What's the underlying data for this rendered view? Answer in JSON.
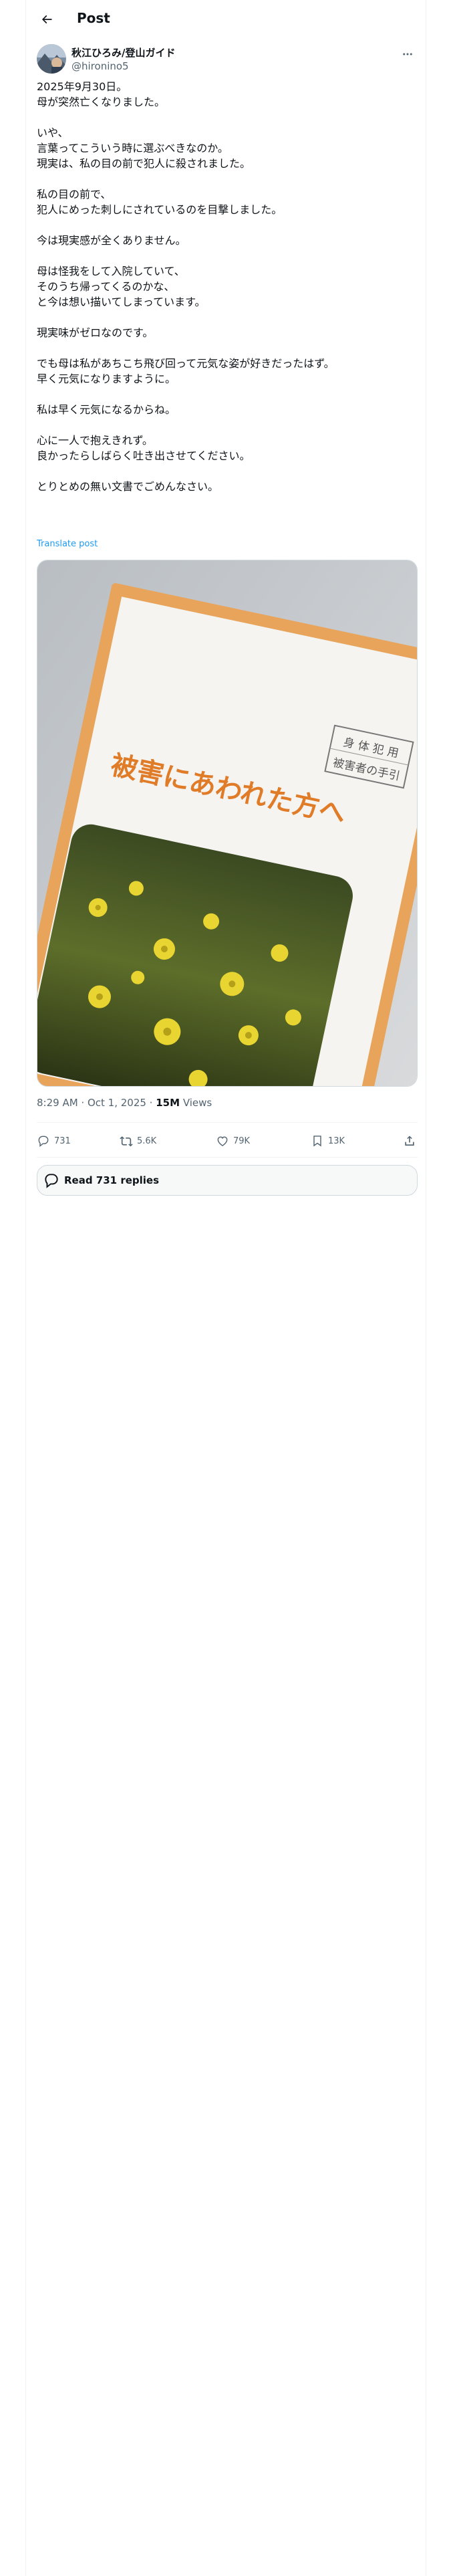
{
  "header": {
    "title": "Post"
  },
  "author": {
    "name": "秋江ひろみ/登山ガイド",
    "handle": "@hironino5"
  },
  "post": {
    "text": "2025年9月30日。\n母が突然亡くなりました。\n\nいや、\n言葉ってこういう時に選ぶべきなのか。\n現実は、私の目の前で犯人に殺されました。\n\n私の目の前で、\n犯人にめった刺しにされているのを目撃しました。\n\n今は現実感が全くありません。\n\n母は怪我をして入院していて、\nそのうち帰ってくるのかな、\nと今は想い描いてしまっています。\n\n現実味がゼロなのです。\n\nでも母は私があちこち飛び回って元気な姿が好きだったはず。\n早く元気になりますように。\n\n私は早く元気になるからね。\n\n心に一人で抱えきれず。\n良かったらしばらく吐き出させてください。\n\nとりとめの無い文書でごめんなさい。",
    "translate_label": "Translate post"
  },
  "media": {
    "booklet_title": "被害にあわれた方へ",
    "booklet_label_line1": "身 体 犯 用",
    "booklet_label_line2": "被害者の手引"
  },
  "meta": {
    "time": "8:29 AM · Oct 1, 2025 · ",
    "views_count": "15M",
    "views_label": " Views"
  },
  "actions": {
    "replies": "731",
    "reposts": "5.6K",
    "likes": "79K",
    "bookmarks": "13K"
  },
  "read_replies": {
    "label": "Read 731 replies"
  },
  "icons": [
    "back-arrow-icon",
    "more-icon",
    "reply-icon",
    "repost-icon",
    "like-icon",
    "bookmark-icon",
    "share-icon",
    "speech-bubble-icon"
  ]
}
